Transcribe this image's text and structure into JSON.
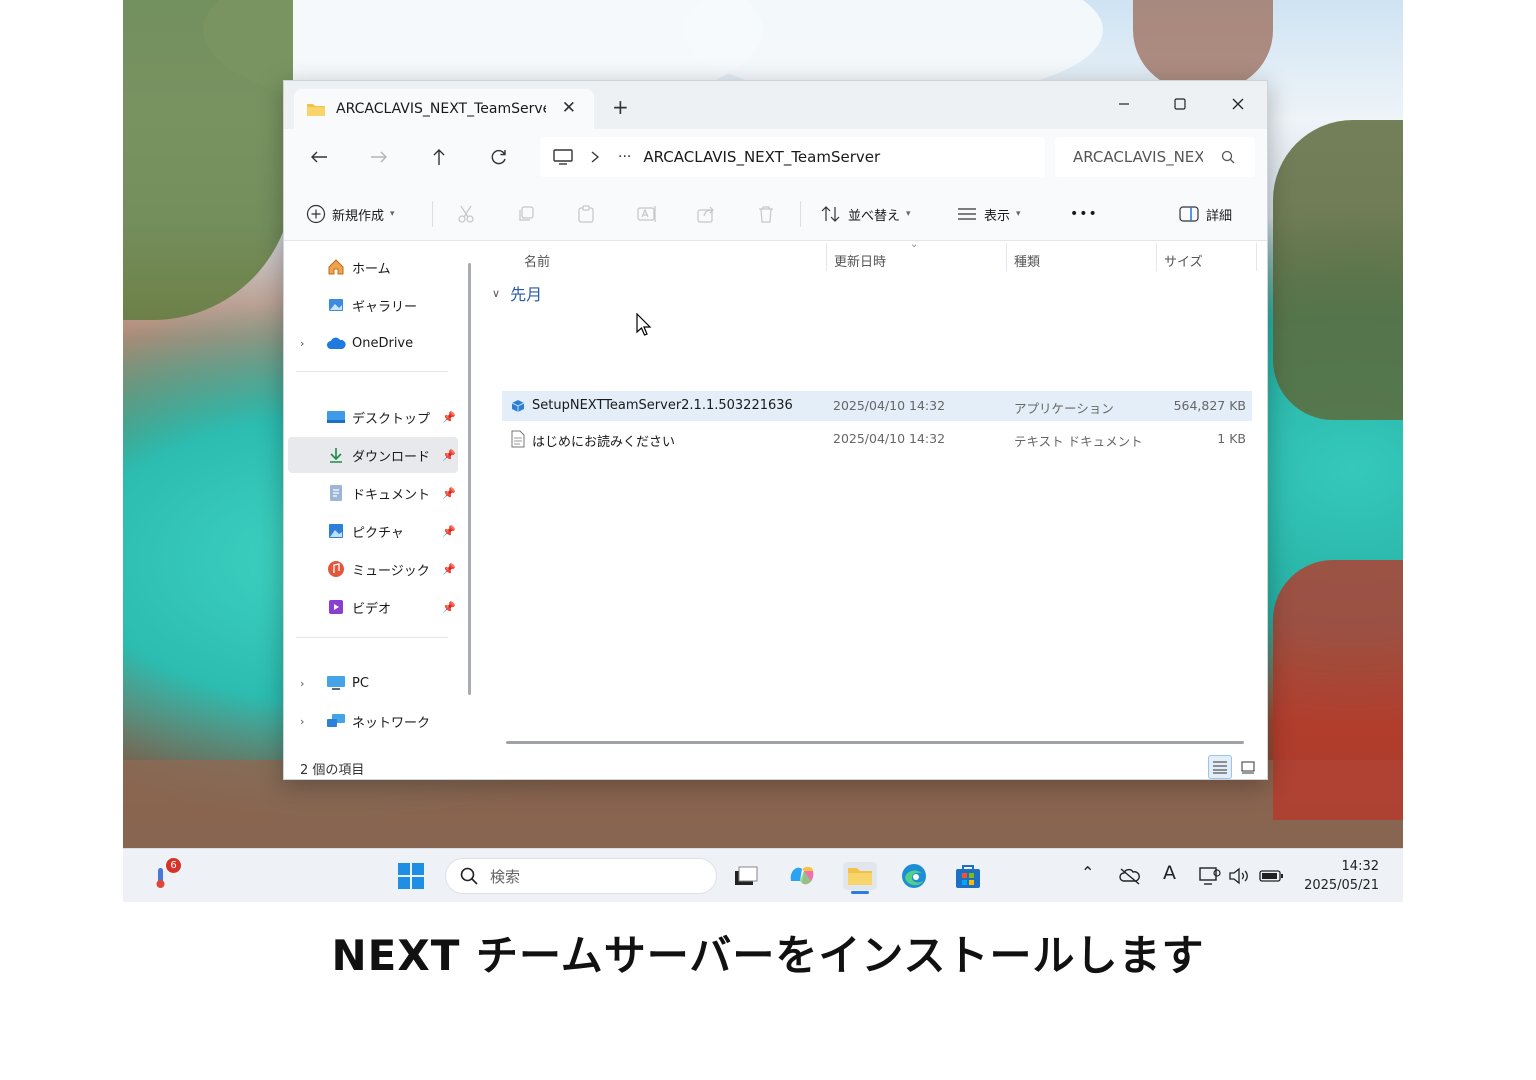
{
  "window": {
    "tab_title": "ARCACLAVIS_NEXT_TeamServer",
    "tab_close": "✕",
    "new_tab": "+",
    "controls": {
      "minimize": "—",
      "maximize": "☐",
      "close": "✕"
    }
  },
  "address_bar": {
    "ellipsis": "···",
    "path": "ARCACLAVIS_NEXT_TeamServer",
    "search_placeholder": "ARCACLAVIS_NEXT_TeamServer"
  },
  "command_bar": {
    "new_label": "新規作成",
    "sort_label": "並べ替え",
    "view_label": "表示",
    "more_label": "•••",
    "details_label": "詳細"
  },
  "sidebar": {
    "home": "ホーム",
    "gallery": "ギャラリー",
    "onedrive": "OneDrive",
    "desktop": "デスクトップ",
    "downloads": "ダウンロード",
    "documents": "ドキュメント",
    "pictures": "ピクチャ",
    "music": "ミュージック",
    "videos": "ビデオ",
    "pc": "PC",
    "network": "ネットワーク"
  },
  "columns": {
    "name": "名前",
    "date": "更新日時",
    "type": "種類",
    "size": "サイズ"
  },
  "group": {
    "label": "先月"
  },
  "files": [
    {
      "name": "SetupNEXTTeamServer2.1.1.503221636",
      "date": "2025/04/10 14:32",
      "type": "アプリケーション",
      "size": "564,827 KB"
    },
    {
      "name": "はじめにお読みください",
      "date": "2025/04/10 14:32",
      "type": "テキスト ドキュメント",
      "size": "1 KB"
    }
  ],
  "status": {
    "item_count": "2 個の項目"
  },
  "taskbar": {
    "notification_badge": "6",
    "search_placeholder": "検索",
    "ime_label": "A",
    "time": "14:32",
    "date": "2025/05/21"
  },
  "caption": "NEXT チームサーバーをインストールします",
  "colors": {
    "accent": "#2a5aa8",
    "selection": "#e3eef9",
    "explorer_bg": "#f9fafb"
  }
}
